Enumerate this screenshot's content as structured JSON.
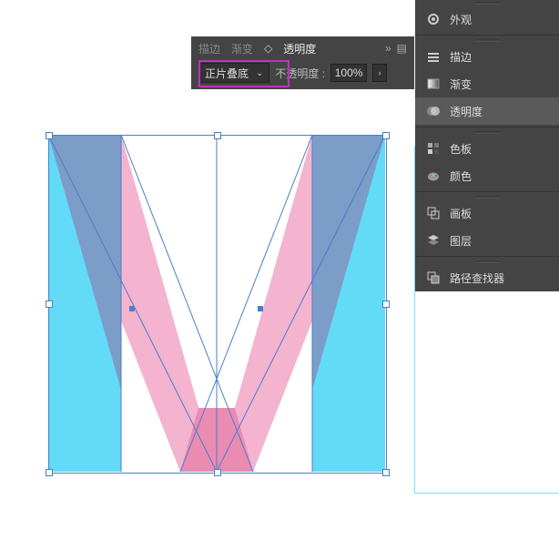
{
  "panel": {
    "tabs": {
      "stroke": "描边",
      "gradient": "渐变",
      "transparency": "透明度"
    },
    "more_glyph": "»",
    "blend_mode": "正片叠底",
    "opacity_label": "不透明度 :",
    "opacity_value": "100%"
  },
  "side": {
    "appearance": "外观",
    "stroke": "描边",
    "gradient": "渐变",
    "transparency": "透明度",
    "swatches": "色板",
    "color": "颜色",
    "artboards": "画板",
    "layers": "图层",
    "pathfinder": "路径查找器"
  },
  "colors": {
    "cyan": "#63daf6",
    "pink": "#f4b3ce",
    "overlap_top": "#7c9dc8",
    "overlap_mid": "#ea8cb2"
  },
  "chart_data": null
}
